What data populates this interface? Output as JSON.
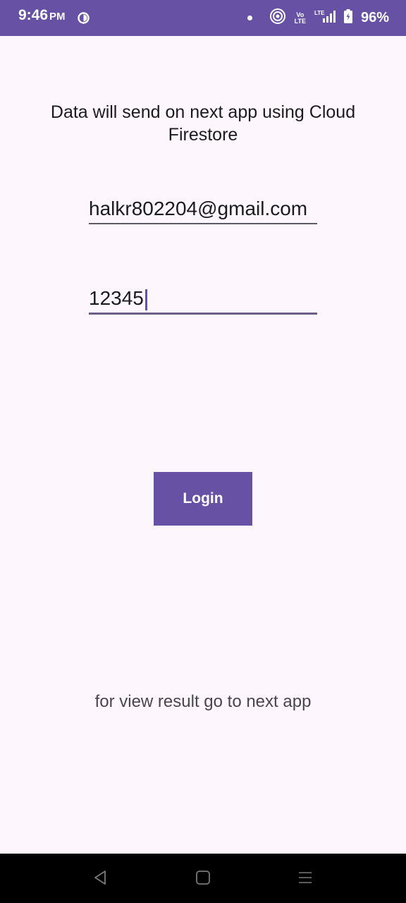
{
  "status_bar": {
    "time": "9:46",
    "ampm": "PM",
    "network": "LTE",
    "volte": "Vo LTE",
    "battery": "96%",
    "icons": [
      "notification-app-icon",
      "dot-icon",
      "hotspot-icon",
      "volte-icon",
      "signal-icon",
      "battery-icon"
    ]
  },
  "main": {
    "heading": "Data will send on next app using Cloud Firestore",
    "email_value": "halkr802204@gmail.com",
    "password_value": "12345",
    "login_label": "Login",
    "footer_text": "for view result go to next app"
  },
  "nav": {
    "icons": [
      "back-icon",
      "home-icon",
      "menu-icon"
    ]
  },
  "colors": {
    "accent": "#6651a4",
    "background": "#fdf7fd",
    "text": "#1b1b1f"
  }
}
